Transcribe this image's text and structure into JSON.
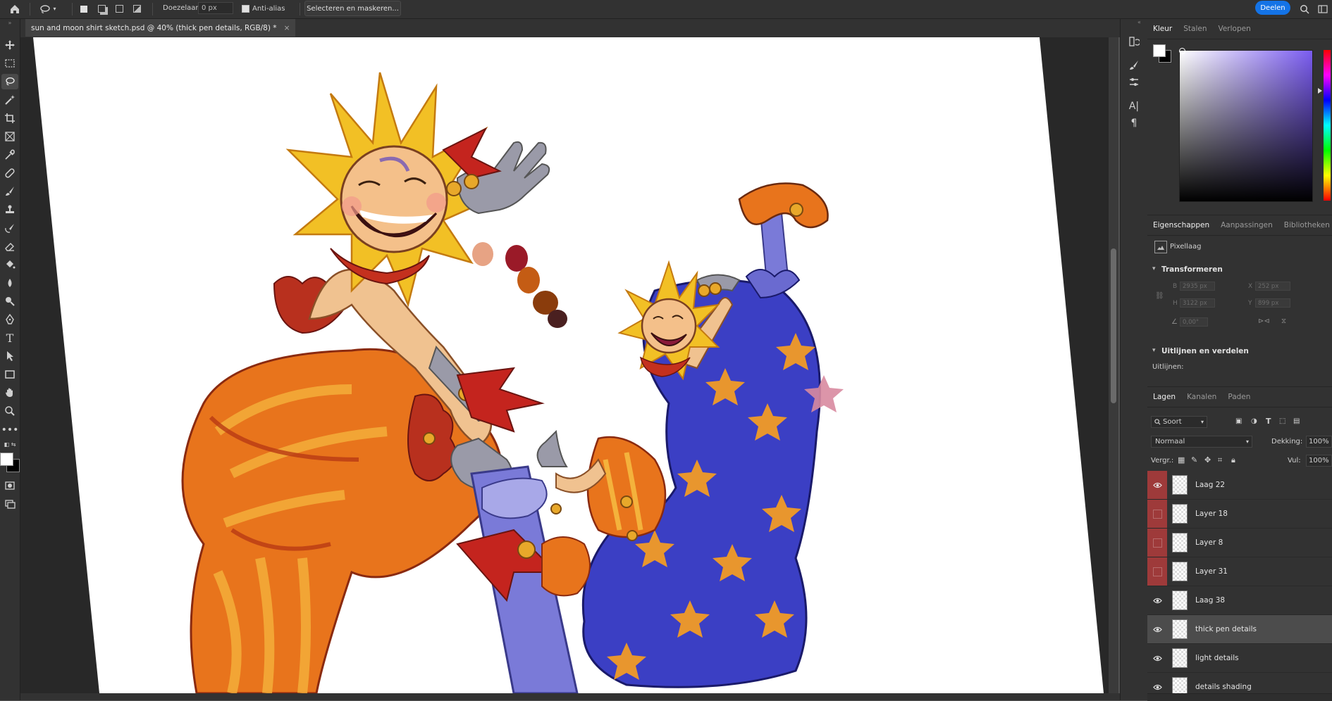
{
  "options_bar": {
    "home_icon": "home-icon",
    "lasso_icon": "lasso-icon",
    "feather_label": "Doezelaar:",
    "feather_value": "0 px",
    "antialias_label": "Anti-alias",
    "antialias_checked": true,
    "select_mask_label": "Selecteren en maskeren...",
    "share_label": "Deelen"
  },
  "document": {
    "tab_title": "sun and moon shirt sketch.psd @ 40% (thick pen details, RGB/8) *",
    "close_glyph": "×"
  },
  "tools": [
    "move-icon",
    "marquee-icon",
    "lasso-icon",
    "magic-wand-icon",
    "crop-icon",
    "frame-icon",
    "eyedropper-icon",
    "healing-icon",
    "brush-icon",
    "stamp-icon",
    "history-brush-icon",
    "eraser-icon",
    "bucket-icon",
    "blur-icon",
    "dodge-icon",
    "pen-icon",
    "type-icon",
    "path-select-icon",
    "rectangle-icon",
    "hand-icon",
    "zoom-icon",
    "more-icon"
  ],
  "color_panel": {
    "tabs": [
      "Kleur",
      "Stalen",
      "Verlopen"
    ],
    "active_tab": "Kleur",
    "foreground": "#ffffff",
    "background": "#000000",
    "picker_hue": "#7a5cf0"
  },
  "properties_panel": {
    "tabs": [
      "Eigenschappen",
      "Aanpassingen",
      "Bibliotheken"
    ],
    "active_tab": "Eigenschappen",
    "layer_type": "Pixellaag",
    "transform_title": "Transformeren",
    "w_label": "B",
    "w_value": "2935 px",
    "h_label": "H",
    "h_value": "3122 px",
    "x_label": "X",
    "x_value": "252 px",
    "y_label": "Y",
    "y_value": "899 px",
    "angle_value": "0,00°",
    "align_title": "Uitlijnen en verdelen",
    "align_label": "Uitlijnen:"
  },
  "layers_panel": {
    "tabs": [
      "Lagen",
      "Kanalen",
      "Paden"
    ],
    "active_tab": "Lagen",
    "filter_label": "Soort",
    "blend_mode": "Normaal",
    "opacity_label": "Dekking:",
    "opacity_value": "100%",
    "lock_label": "Vergr.:",
    "fill_label": "Vul:",
    "fill_value": "100%",
    "layers": [
      {
        "name": "Laag 22",
        "visible": true,
        "flagged": true,
        "selected": false
      },
      {
        "name": "Layer 18",
        "visible": false,
        "flagged": true,
        "selected": false
      },
      {
        "name": "Layer 8",
        "visible": false,
        "flagged": true,
        "selected": false
      },
      {
        "name": "Layer 31",
        "visible": false,
        "flagged": true,
        "selected": false
      },
      {
        "name": "Laag 38",
        "visible": true,
        "flagged": false,
        "selected": false
      },
      {
        "name": "thick pen details",
        "visible": true,
        "flagged": false,
        "selected": true
      },
      {
        "name": "light details",
        "visible": true,
        "flagged": false,
        "selected": false
      },
      {
        "name": "details shading",
        "visible": true,
        "flagged": false,
        "selected": false
      }
    ]
  },
  "colors": {
    "accent": "#1473e6",
    "flag_red": "#9e3a3a",
    "sun_orange": "#e8741c",
    "moon_blue": "#3b3fc4",
    "star_orange": "#e8962e"
  },
  "swatches": [
    "#e7a384",
    "#9a1a28",
    "#c45c14",
    "#8a3c0c",
    "#4a2020"
  ]
}
